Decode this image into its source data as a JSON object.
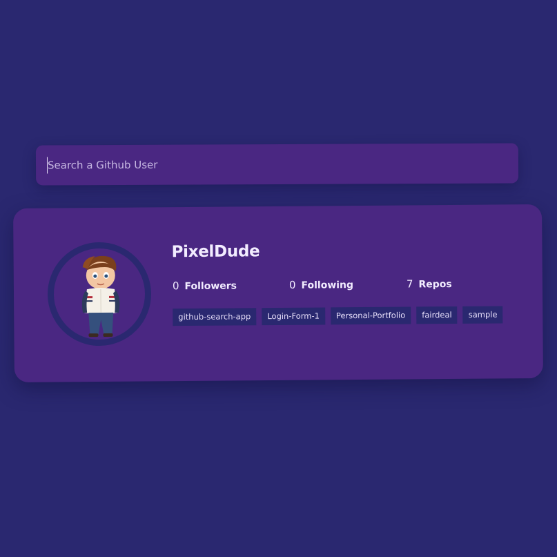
{
  "search": {
    "placeholder": "Search a Github User"
  },
  "profile": {
    "username": "PixelDude",
    "avatar_alt": "boss-baby-avatar",
    "stats": {
      "followers": {
        "count": "0",
        "label": "Followers"
      },
      "following": {
        "count": "0",
        "label": "Following"
      },
      "repos": {
        "count": "7",
        "label": "Repos"
      }
    },
    "repositories": [
      "github-search-app",
      "Login-Form-1",
      "Personal-Portfolio",
      "fairdeal",
      "sample"
    ]
  },
  "colors": {
    "background": "#2a2870",
    "card": "#4a2782",
    "text": "#f2ecff"
  }
}
